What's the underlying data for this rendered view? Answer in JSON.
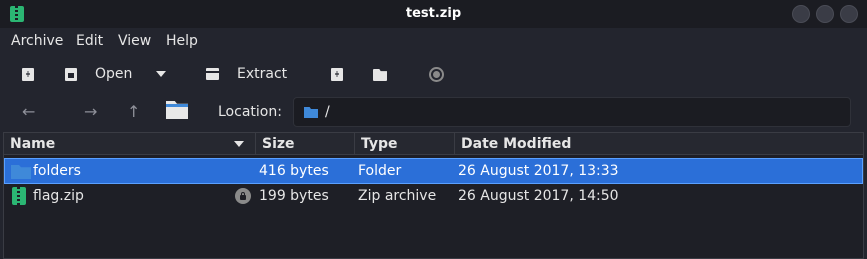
{
  "window": {
    "title": "test.zip"
  },
  "menu": {
    "items": [
      "Archive",
      "Edit",
      "View",
      "Help"
    ]
  },
  "toolbar": {
    "open_label": "Open",
    "extract_label": "Extract"
  },
  "location": {
    "label": "Location:",
    "path": "/"
  },
  "columns": [
    "Name",
    "Size",
    "Type",
    "Date Modified"
  ],
  "rows": [
    {
      "name": "folders",
      "size": "416 bytes",
      "type": "Folder",
      "date": "26 August 2017, 13:33",
      "icon": "folder-icon",
      "selected": true
    },
    {
      "name": "flag.zip",
      "size": "199 bytes",
      "type": "Zip archive",
      "date": "26 August 2017, 14:50",
      "icon": "zip-icon",
      "encrypted": true
    }
  ],
  "colors": {
    "selection": "#2b6fd8",
    "folder": "#3f89d9",
    "zip": "#2bb673",
    "background": "#23252e"
  }
}
